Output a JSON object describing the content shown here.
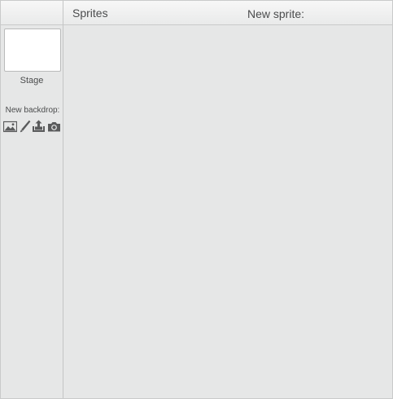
{
  "header": {
    "sprites_title": "Sprites",
    "new_sprite_label": "New sprite:"
  },
  "stage_panel": {
    "stage_label": "Stage",
    "new_backdrop_label": "New backdrop:",
    "tools": [
      {
        "name": "paint-from-library-icon"
      },
      {
        "name": "paint-new-brush-icon"
      },
      {
        "name": "upload-from-file-icon"
      },
      {
        "name": "camera-icon"
      }
    ]
  },
  "colors": {
    "panel_background": "#e6e7e7",
    "header_gradient_top": "#f7f7f7",
    "header_gradient_bottom": "#e9eaea",
    "border": "#c9caca",
    "text": "#4b4c4d",
    "icon": "#5a5b5c"
  }
}
